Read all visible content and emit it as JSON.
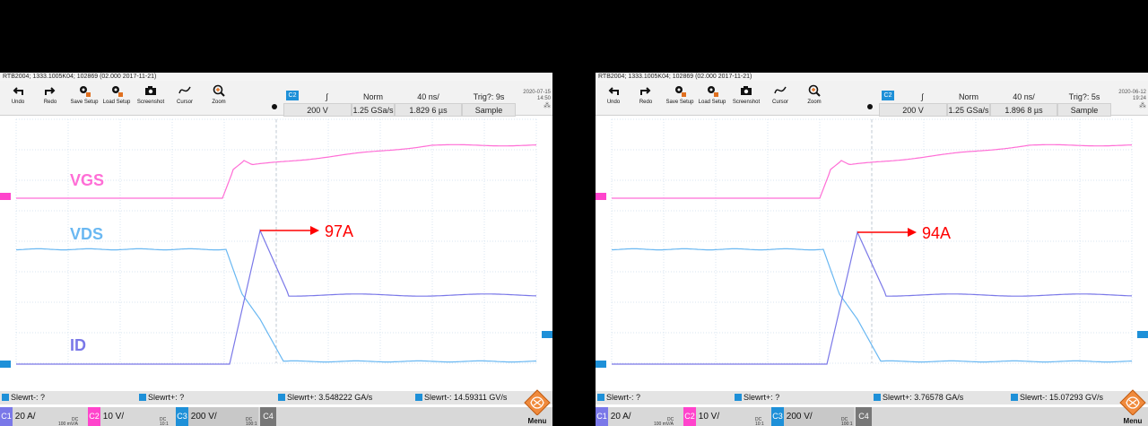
{
  "colors": {
    "vgs": "#ff6ed6",
    "vds": "#6ab8f2",
    "id": "#7a78e8",
    "annotation": "#ff0000",
    "ch1": "#1e90d8",
    "ch2": "#ff44cc",
    "ch3": "#1e90d8",
    "ch4": "#777777"
  },
  "toolbar_labels": {
    "undo": "Undo",
    "redo": "Redo",
    "save": "Save Setup",
    "load": "Load Setup",
    "screenshot": "Screenshot",
    "cursor": "Cursor",
    "zoom": "Zoom"
  },
  "icons": [
    "undo-icon",
    "redo-icon",
    "save-setup-icon",
    "load-setup-icon",
    "camera-icon",
    "cursor-icon",
    "zoom-icon",
    "menu-icon"
  ],
  "left": {
    "title": "RTB2004; 1333.1005K04; 102869 (02.000 2017-11-21)",
    "params": {
      "ch": "C2",
      "scale": "200 V",
      "slope": "∫",
      "mode": "Norm",
      "samplerate": "1.25 GSa/s",
      "timebase": "40 ns/",
      "position": "1.829 6 µs",
      "trig": "Trig?: 9s",
      "acq": "Sample"
    },
    "date": {
      "d": "2020-07-15",
      "t": "14:50"
    },
    "labels": {
      "vgs": "VGS",
      "vds": "VDS",
      "id": "ID",
      "peak": "97A"
    },
    "status": {
      "s1": "Slewrt-: ?",
      "s2": "Slewrt+: ?",
      "s3": "Slewrt+: 3.548222 GA/s",
      "s4": "Slewrt-: 14.59311 GV/s"
    },
    "channels": {
      "c1": "20 A/",
      "c1sub": "100 mV/A",
      "c1dc": "DC",
      "c2": "10 V/",
      "c2dc": "DC",
      "c2sub": "10:1",
      "c3": "200 V/",
      "c3dc": "DC",
      "c3sub": "100:1",
      "c4": "C4"
    },
    "menu": "Menu"
  },
  "right": {
    "title": "RTB2004; 1333.1005K04; 102869 (02.000 2017-11-21)",
    "params": {
      "ch": "C2",
      "scale": "200 V",
      "slope": "∫",
      "mode": "Norm",
      "samplerate": "1.25 GSa/s",
      "timebase": "40 ns/",
      "position": "1.896 8 µs",
      "trig": "Trig?: 5s",
      "acq": "Sample"
    },
    "date": {
      "d": "2020-06-12",
      "t": "19:24"
    },
    "labels": {
      "vgs": "",
      "vds": "",
      "id": "",
      "peak": "94A"
    },
    "status": {
      "s1": "Slewrt-: ?",
      "s2": "Slewrt+: ?",
      "s3": "Slewrt+: 3.76578 GA/s",
      "s4": "Slewrt-: 15.07293 GV/s"
    },
    "channels": {
      "c1": "20 A/",
      "c1sub": "100 mV/A",
      "c1dc": "DC",
      "c2": "10 V/",
      "c2dc": "DC",
      "c2sub": "10:1",
      "c3": "200 V/",
      "c3dc": "DC",
      "c3sub": "100:1",
      "c4": "C4"
    },
    "menu": "Menu"
  }
}
